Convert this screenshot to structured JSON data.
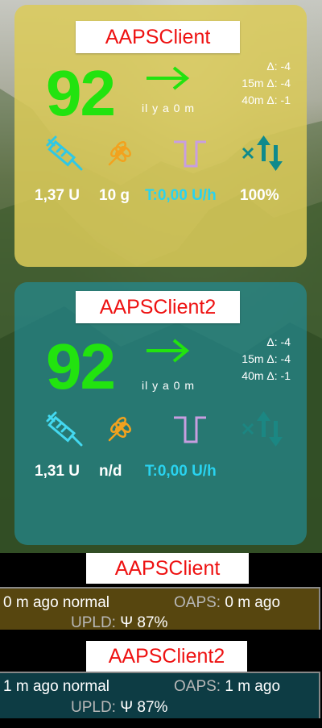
{
  "widgets": [
    {
      "title": "AAPSClient",
      "bg": "92",
      "ago": "il y a 0 m",
      "delta": "Δ: -4",
      "delta15": "15m Δ: -4",
      "delta40": "40m Δ: -1",
      "iob": "1,37 U",
      "cob": "10 g",
      "temp": "T:0,00 U/h",
      "pct": "100%"
    },
    {
      "title": "AAPSClient2",
      "bg": "92",
      "ago": "il y a 0 m",
      "delta": "Δ: -4",
      "delta15": "15m Δ: -4",
      "delta40": "40m Δ: -1",
      "iob": "1,31 U",
      "cob": "n/d",
      "temp": "T:0,00 U/h"
    }
  ],
  "status_widgets": [
    {
      "title": "AAPSClient",
      "left": "0 m ago normal",
      "oaps_label": "OAPS:",
      "oaps_value": "0 m ago",
      "upld_label": "UPLD:",
      "upld_value": "Ψ 87%"
    },
    {
      "title": "AAPSClient2",
      "left": "1 m ago normal",
      "oaps_label": "OAPS:",
      "oaps_value": "1 m ago",
      "upld_label": "UPLD:",
      "upld_value": "Ψ 87%"
    }
  ],
  "colors": {
    "bg_green": "#22e30f",
    "title_red": "#ee1111",
    "temp_cyan": "#29d3f0",
    "widget1": "#dbcb58",
    "widget2": "#228c96",
    "status1": "#57460f",
    "status2": "#0d3c44"
  },
  "icons": [
    "syringe-icon",
    "carbs-wheat-icon",
    "temp-basal-icon",
    "loop-closed-icon",
    "trend-arrow-icon"
  ]
}
